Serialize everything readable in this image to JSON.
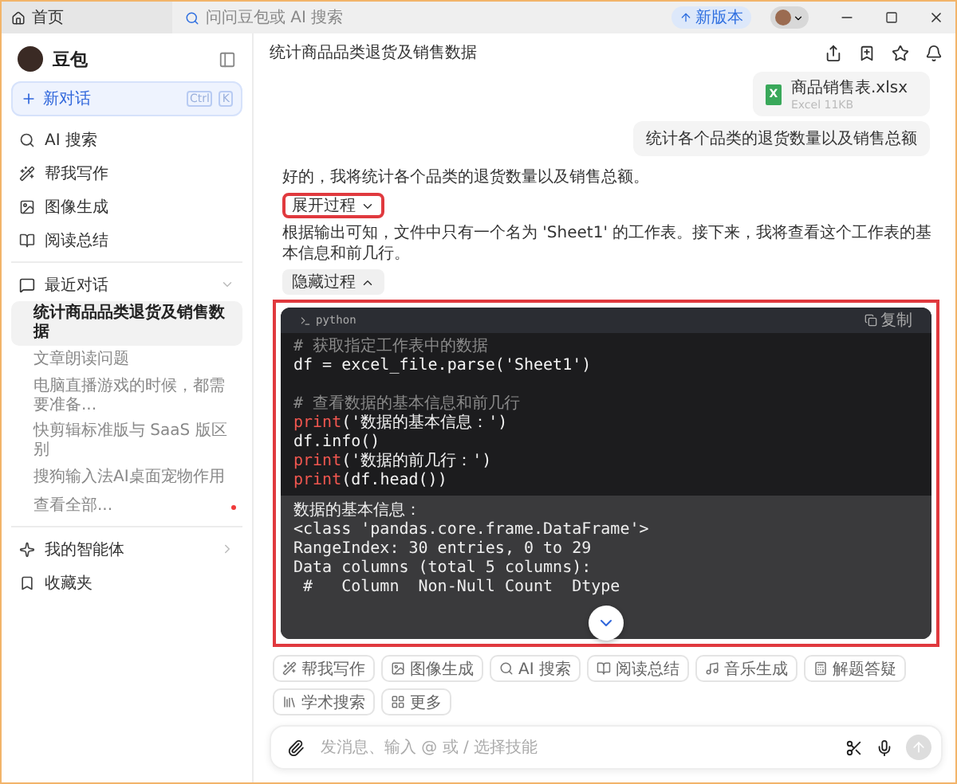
{
  "tab_bar": {
    "home_tab": "首页",
    "search_placeholder": "问问豆包或 AI 搜索",
    "new_version": "新版本"
  },
  "sidebar": {
    "app_name": "豆包",
    "new_chat": {
      "label": "新对话",
      "shortcut": [
        "Ctrl",
        "K"
      ]
    },
    "nav": [
      {
        "kind": "search",
        "label": "AI 搜索"
      },
      {
        "kind": "write",
        "label": "帮我写作"
      },
      {
        "kind": "image",
        "label": "图像生成"
      },
      {
        "kind": "read",
        "label": "阅读总结"
      }
    ],
    "recent": {
      "title": "最近对话",
      "expanded": true,
      "items": [
        {
          "label": "统计商品品类退货及销售数据",
          "selected": true
        },
        {
          "label": "文章朗读问题",
          "selected": false
        },
        {
          "label": "电脑直播游戏的时候，都需要准备...",
          "selected": false
        },
        {
          "label": "快剪辑标准版与 SaaS 版区别",
          "selected": false
        },
        {
          "label": "搜狗输入法AI桌面宠物作用",
          "selected": false
        }
      ],
      "view_all": {
        "label": "查看全部...",
        "unread": true
      }
    },
    "bottom": [
      {
        "kind": "agent",
        "label": "我的智能体",
        "arrow": true
      },
      {
        "kind": "favorites",
        "label": "收藏夹",
        "arrow": false
      }
    ]
  },
  "chat": {
    "title": "统计商品品类退货及销售数据",
    "attachment": {
      "name": "商品销售表.xlsx",
      "meta": "Excel 11KB",
      "badge": "X"
    },
    "user_message": "统计各个品类的退货数量以及销售总额",
    "assistant": [
      {
        "kind": "text",
        "text": "好的，我将统计各个品类的退货数量以及销售总额。"
      },
      {
        "kind": "toggle",
        "label": "展开过程",
        "expanded": false,
        "highlighted": true
      },
      {
        "kind": "text",
        "text": "根据输出可知，文件中只有一个名为 'Sheet1' 的工作表。接下来，我将查看这个工作表的基本信息和前几行。"
      },
      {
        "kind": "toggle",
        "label": "隐藏过程",
        "expanded": true,
        "highlighted": false
      },
      {
        "kind": "code",
        "language": "python",
        "copy": "复制",
        "highlighted": true,
        "lines": [
          {
            "kind": "code",
            "parts": [
              {
                "kind": "comment",
                "text": "# 获取指定工作表中的数据"
              }
            ]
          },
          {
            "kind": "code",
            "parts": [
              {
                "kind": "plain",
                "text": "df = excel_file.parse('Sheet1')"
              }
            ]
          },
          {
            "kind": "blank"
          },
          {
            "kind": "code",
            "parts": [
              {
                "kind": "comment",
                "text": "# 查看数据的基本信息和前几行"
              }
            ]
          },
          {
            "kind": "code",
            "parts": [
              {
                "kind": "keyword",
                "text": "print"
              },
              {
                "kind": "plain",
                "text": "('数据的基本信息：')"
              }
            ]
          },
          {
            "kind": "code",
            "parts": [
              {
                "kind": "plain",
                "text": "df.info()"
              }
            ]
          },
          {
            "kind": "code",
            "parts": [
              {
                "kind": "keyword",
                "text": "print"
              },
              {
                "kind": "plain",
                "text": "('数据的前几行：')"
              }
            ]
          },
          {
            "kind": "code",
            "parts": [
              {
                "kind": "keyword",
                "text": "print"
              },
              {
                "kind": "plain",
                "text": "(df.head())"
              }
            ]
          }
        ],
        "output": [
          "数据的基本信息：",
          "<class 'pandas.core.frame.DataFrame'>",
          "RangeIndex: 30 entries, 0 to 29",
          "Data columns (total 5 columns):",
          " #   Column  Non-Null Count  Dtype"
        ]
      }
    ],
    "chips": [
      {
        "kind": "write",
        "label": "帮我写作"
      },
      {
        "kind": "image",
        "label": "图像生成"
      },
      {
        "kind": "search",
        "label": "AI 搜索"
      },
      {
        "kind": "read",
        "label": "阅读总结"
      },
      {
        "kind": "music",
        "label": "音乐生成"
      },
      {
        "kind": "solve",
        "label": "解题答疑"
      },
      {
        "kind": "academic",
        "label": "学术搜索"
      },
      {
        "kind": "more",
        "label": "更多"
      }
    ],
    "input": {
      "placeholder": "发消息、输入 @ 或 / 选择技能"
    }
  }
}
